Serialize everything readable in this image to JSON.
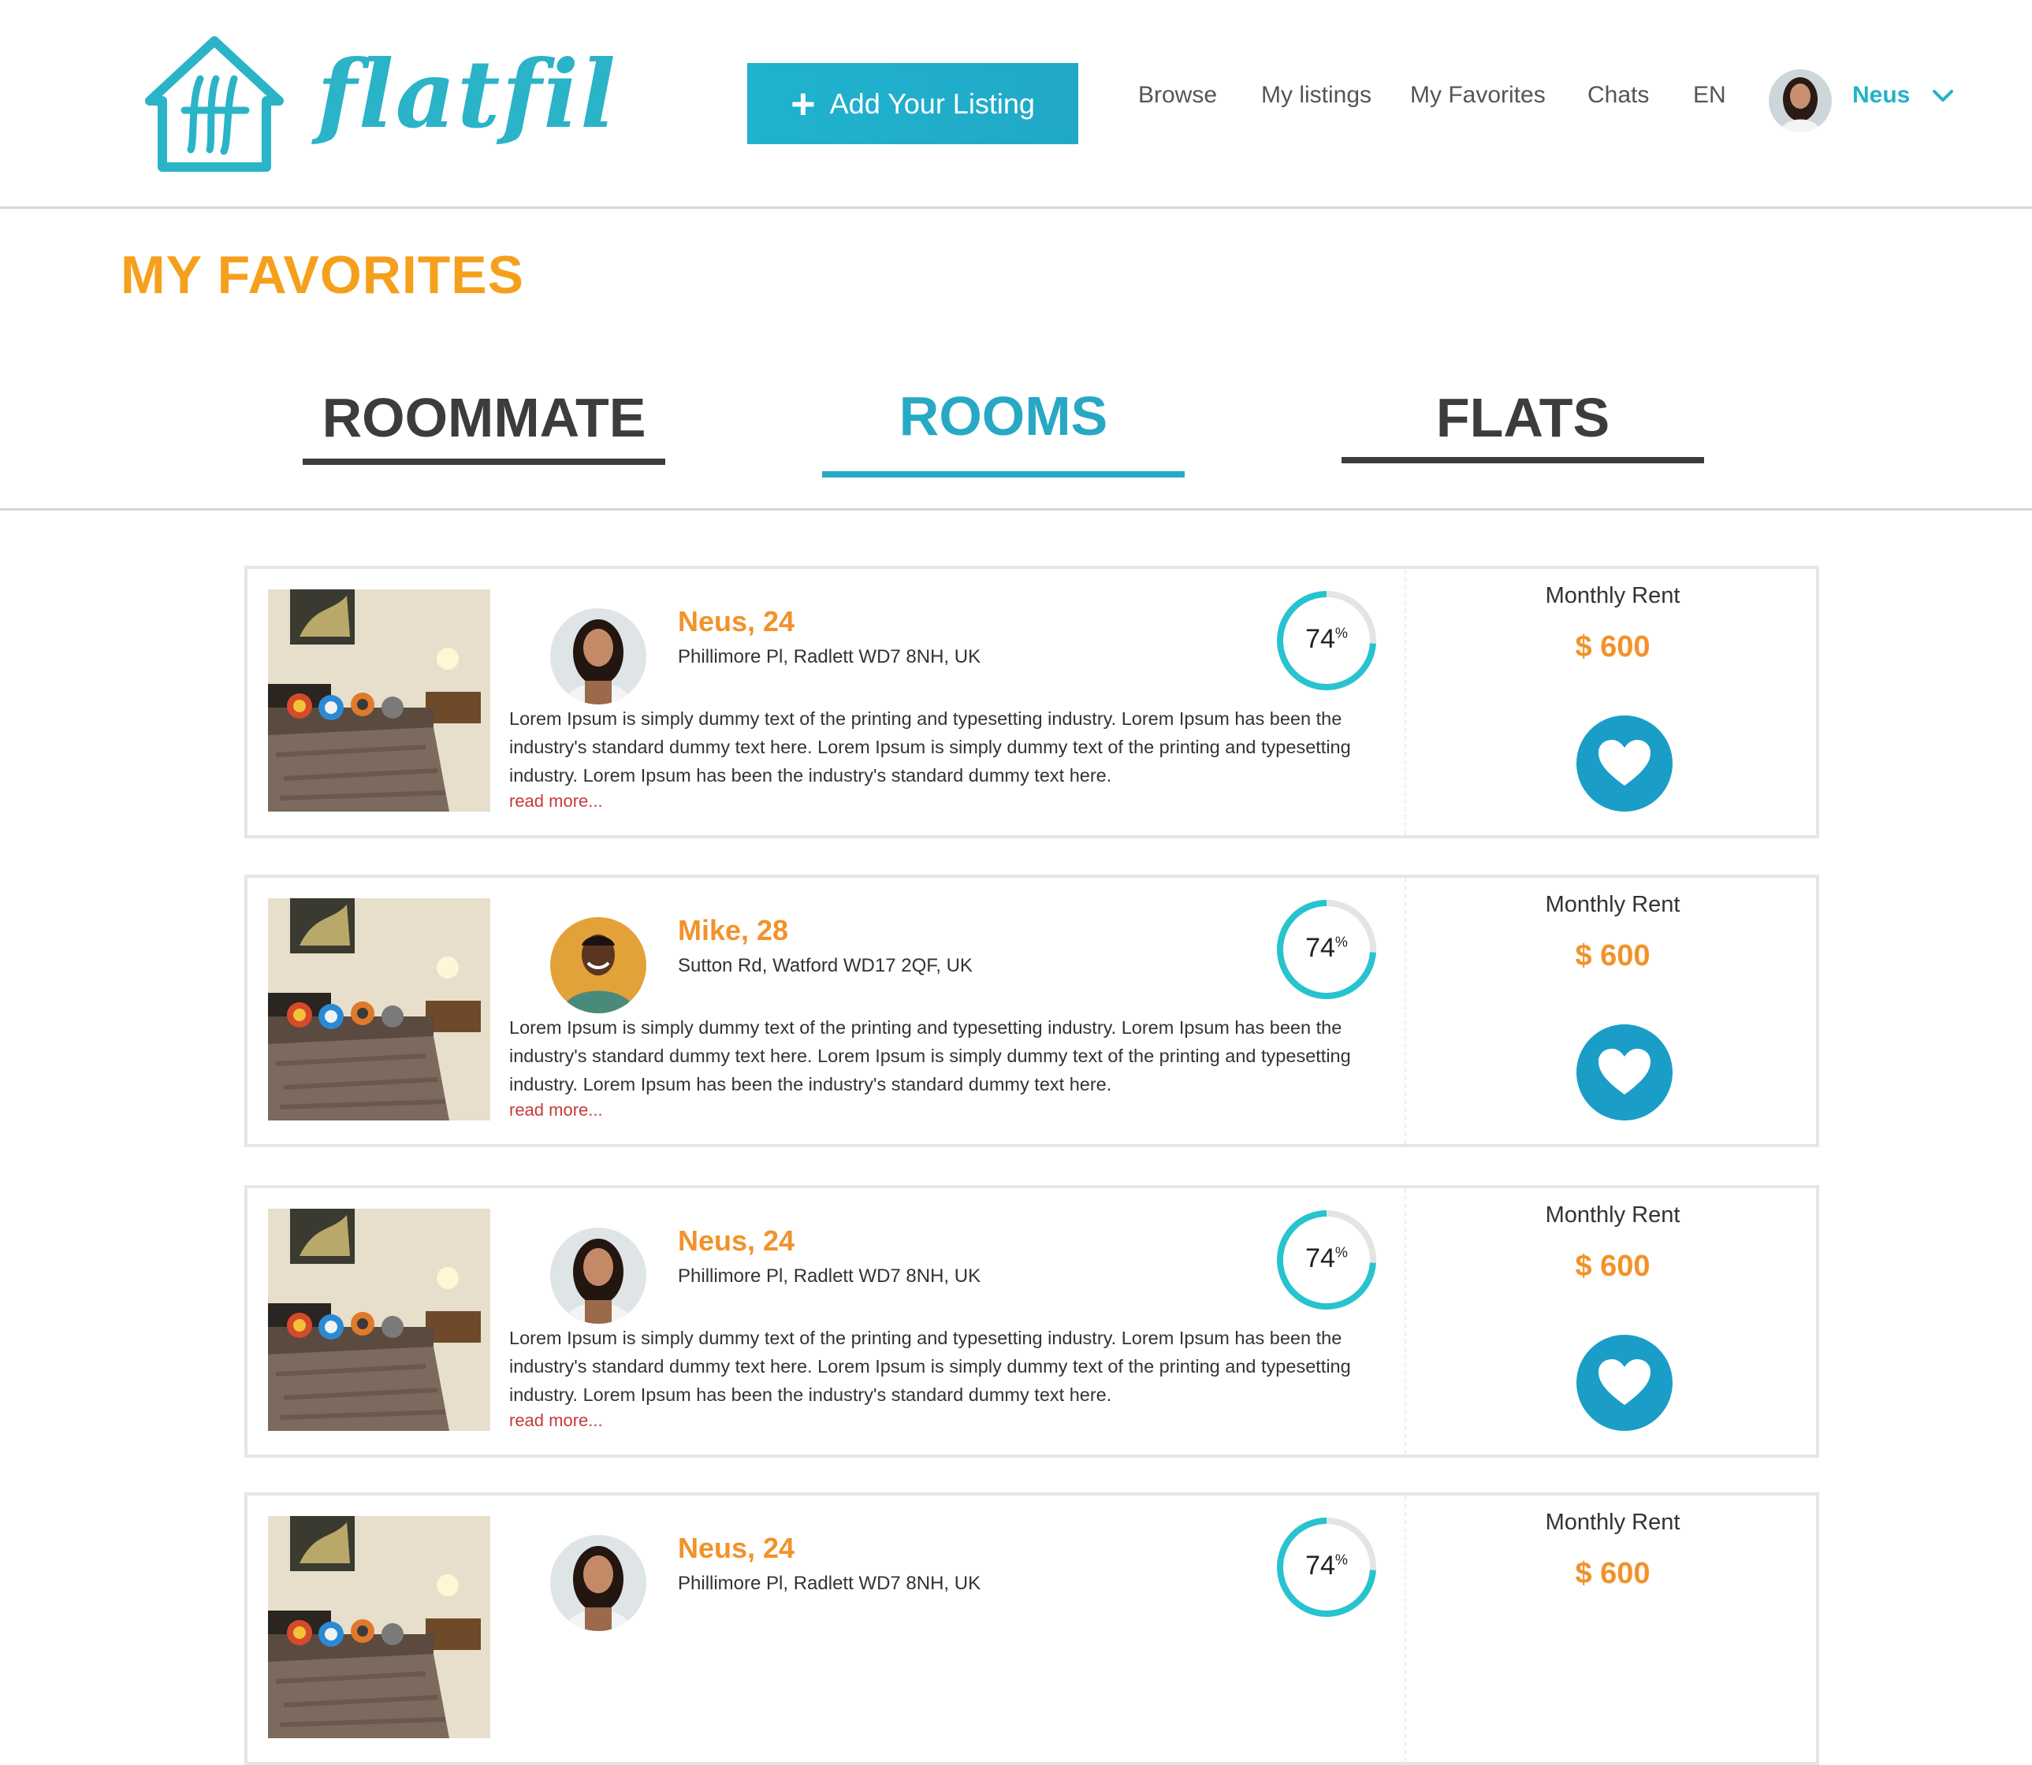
{
  "header": {
    "logo_text": "flatfil",
    "add_listing": "Add Your Listing",
    "nav": [
      "Browse",
      "My listings",
      "My Favorites",
      "Chats",
      "EN"
    ],
    "user_name": "Neus"
  },
  "page_title": "MY FAVORITES",
  "tabs": [
    {
      "label": "ROOMMATE",
      "active": false
    },
    {
      "label": "ROOMS",
      "active": true
    },
    {
      "label": "FLATS",
      "active": false
    }
  ],
  "listings": [
    {
      "name": "Neus, 24",
      "address": "Phillimore Pl, Radlett WD7 8NH, UK",
      "match": "74",
      "match_fraction": 0.74,
      "description": "Lorem Ipsum is simply dummy text of the printing and typesetting industry. Lorem Ipsum has been the industry's standard dummy text here. Lorem Ipsum is simply dummy text of the printing and typesetting industry. Lorem Ipsum has been the industry's standard dummy text here.",
      "read_more": "read more...",
      "rent_label": "Monthly Rent",
      "price": "$ 600"
    },
    {
      "name": "Mike, 28",
      "address": "Sutton Rd, Watford WD17 2QF, UK",
      "match": "74",
      "match_fraction": 0.74,
      "description": "Lorem Ipsum is simply dummy text of the printing and typesetting industry. Lorem Ipsum has been the industry's standard dummy text here. Lorem Ipsum is simply dummy text of the printing and typesetting industry. Lorem Ipsum has been the industry's standard dummy text here.",
      "read_more": "read more...",
      "rent_label": "Monthly Rent",
      "price": "$ 600"
    },
    {
      "name": "Neus, 24",
      "address": "Phillimore Pl, Radlett WD7 8NH, UK",
      "match": "74",
      "match_fraction": 0.74,
      "description": "Lorem Ipsum is simply dummy text of the printing and typesetting industry. Lorem Ipsum has been the industry's standard dummy text here. Lorem Ipsum is simply dummy text of the printing and typesetting industry. Lorem Ipsum has been the industry's standard dummy text here.",
      "read_more": "read more...",
      "rent_label": "Monthly Rent",
      "price": "$ 600"
    },
    {
      "name": "Neus, 24",
      "address": "Phillimore Pl, Radlett WD7 8NH, UK",
      "match": "74",
      "match_fraction": 0.74,
      "rent_label": "Monthly Rent",
      "price": "$ 600"
    }
  ],
  "colors": {
    "accent": "#23b2c6",
    "orange": "#f5a01d",
    "price": "#f2922a",
    "heart_bg": "#1a9ec7"
  },
  "icons": {
    "plus": "plus-icon",
    "chevron": "chevron-down-icon",
    "heart": "heart-icon",
    "logo": "house-logo-icon"
  }
}
